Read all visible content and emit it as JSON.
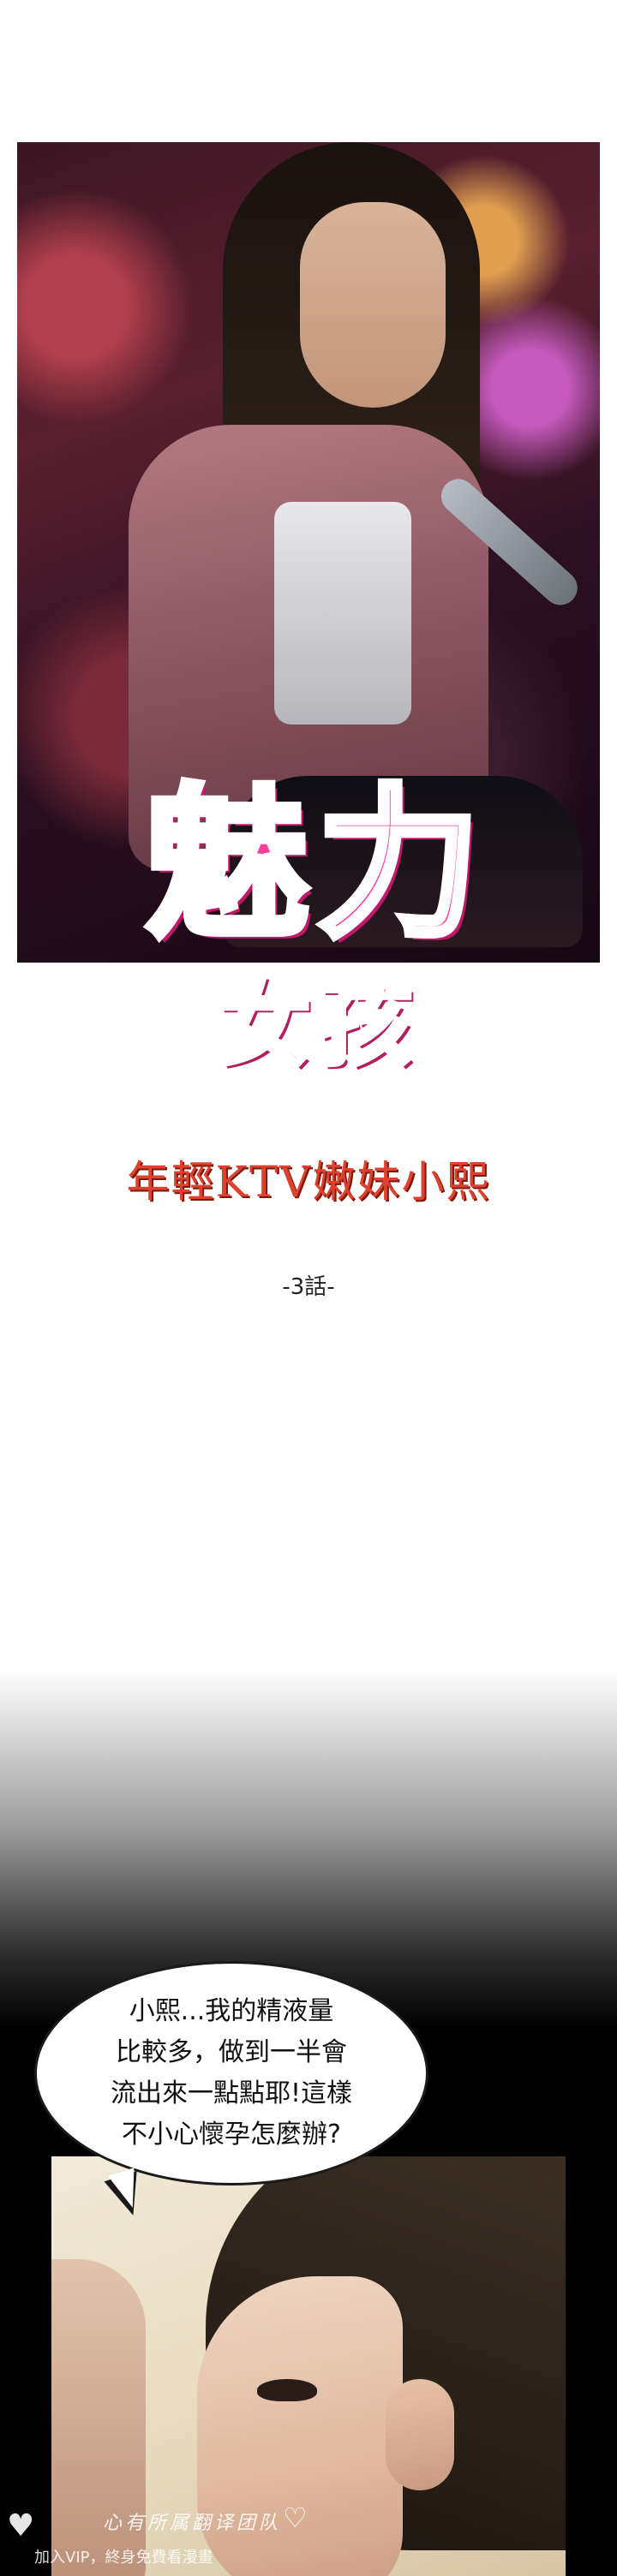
{
  "logo": {
    "main": "魅力",
    "sub": "女孩"
  },
  "episode": {
    "subtitle": "年輕KTV嫩妹小熙",
    "number": "-3話-"
  },
  "dialogue": {
    "lines": [
      "小熙...我的精液量",
      "比較多，做到一半會",
      "流出來一點點耶!這樣",
      "不小心懷孕怎麼辦?"
    ]
  },
  "watermark": {
    "title": "心有所属翻译团队",
    "text": "加入VIP，終身免費看漫畫",
    "heart_icon": "heart-icon"
  },
  "colors": {
    "logo_pink": "#ff3f9a",
    "subtitle_red": "#e0412f"
  }
}
